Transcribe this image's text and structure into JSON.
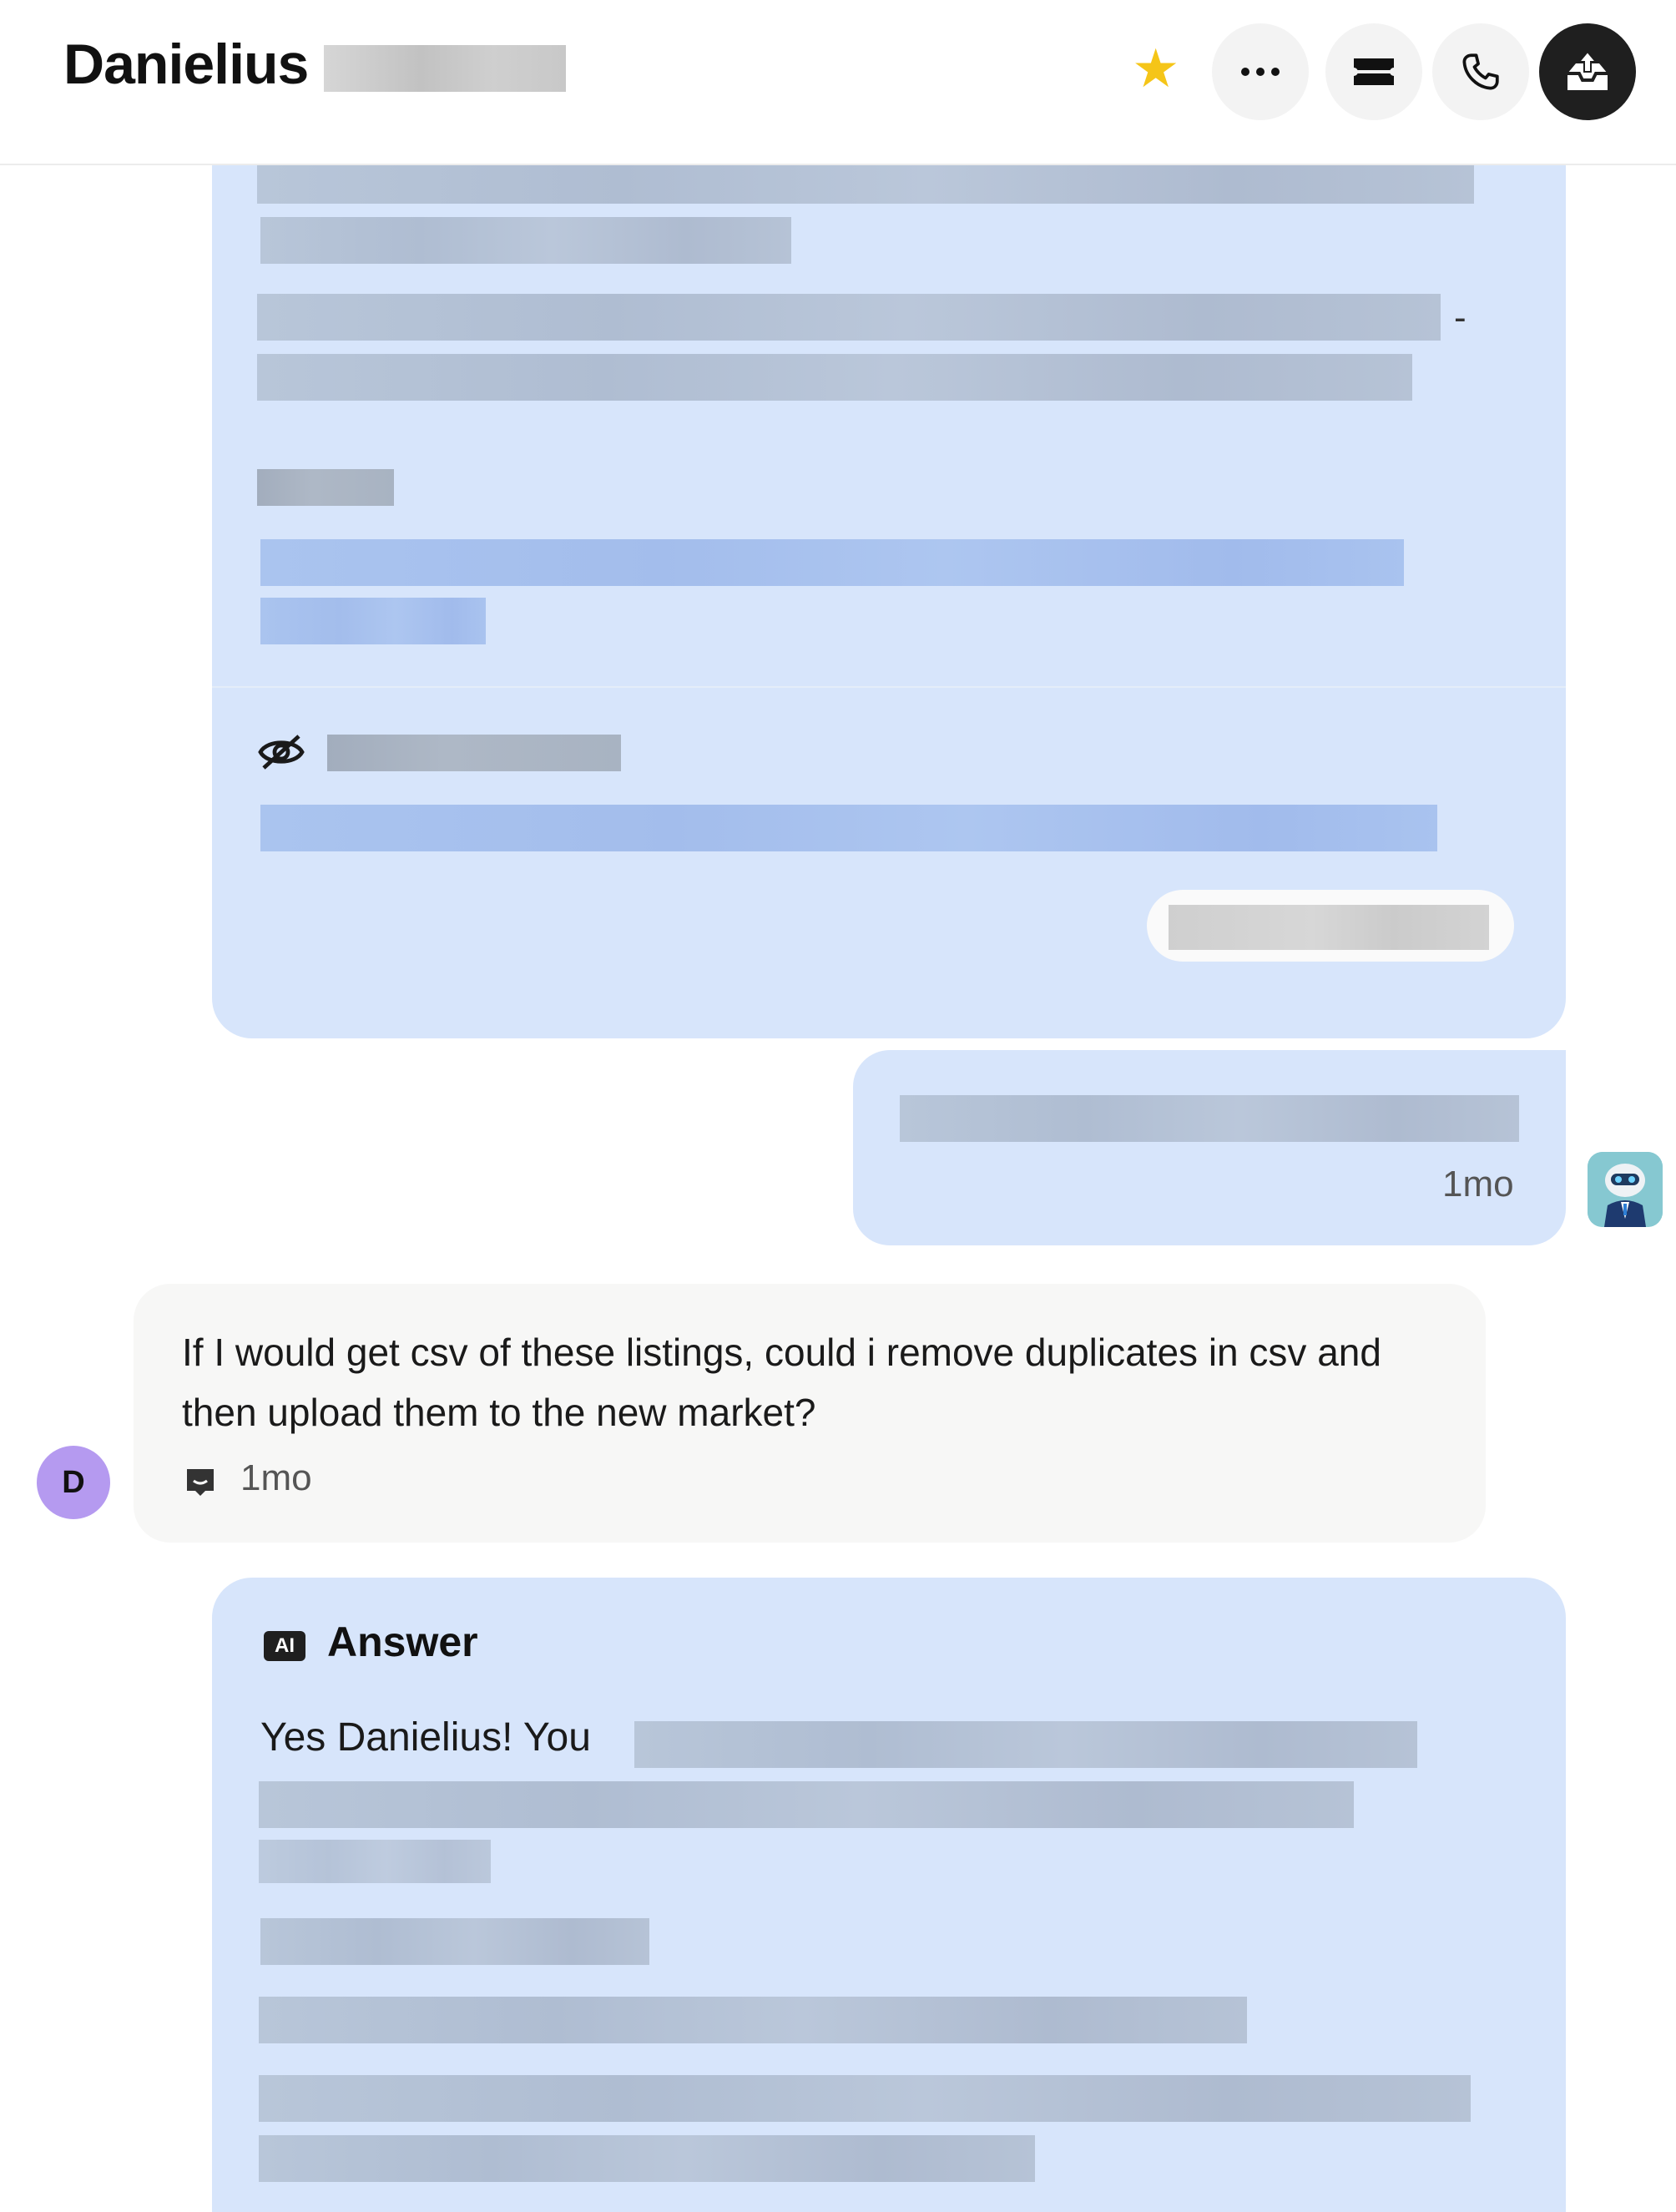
{
  "header": {
    "title": "Danielius",
    "star_icon": "star-icon",
    "buttons": [
      {
        "name": "more-options",
        "icon": "ellipsis-icon"
      },
      {
        "name": "ticket",
        "icon": "ticket-icon"
      },
      {
        "name": "call",
        "icon": "phone-icon"
      },
      {
        "name": "inbox-upload",
        "icon": "inbox-upload-icon"
      }
    ],
    "colors": {
      "star": "#f5c518",
      "dark_button": "#1f1f1f"
    }
  },
  "messages": [
    {
      "id": "bot-reply-1",
      "time": "1mo"
    },
    {
      "id": "user-message",
      "avatar_initial": "D",
      "text": "If I would get csv of these listings, could i remove duplicates in csv and then upload them to the new market?",
      "time": "1mo"
    },
    {
      "id": "ai-answer",
      "badge": "AI",
      "title": "Answer",
      "text_start": "Yes Danielius! You"
    }
  ],
  "colors": {
    "bubble_blue": "#d7e5fb",
    "bubble_gray": "#f7f7f6",
    "avatar_purple": "#b59af0"
  }
}
